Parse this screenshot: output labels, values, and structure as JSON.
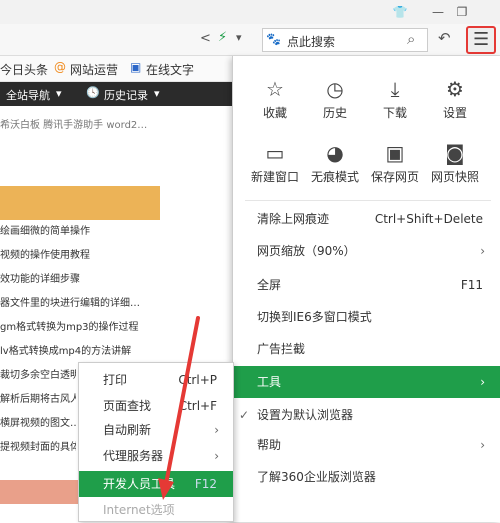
{
  "titlebar": {
    "pin_glyph": "👕",
    "min_glyph": "—",
    "restore_glyph": "❐"
  },
  "toolbar": {
    "share_glyph": "<",
    "bolt_glyph": "⚡",
    "dropdown_glyph": "▾",
    "paw_glyph": "🐾",
    "search_placeholder": "点此搜索",
    "search_glyph": "⌕",
    "undo_glyph": "↶",
    "menu_glyph": "☰"
  },
  "bookmarks": [
    {
      "icon": "",
      "label": "今日头条"
    },
    {
      "icon": "@",
      "label": "网站运营"
    },
    {
      "icon": "▣",
      "label": "在线文字"
    }
  ],
  "navbar": {
    "nav_label": "全站导航",
    "nav_arrow": "▾",
    "history_icon": "🕓",
    "history_label": "历史记录",
    "history_arrow": "▾"
  },
  "hotlinks": "希沃白板  腾讯手游助手  word2…",
  "articles": [
    "绘画细微的简单操作",
    "视频的操作使用教程",
    "效功能的详细步骤",
    "器文件里的块进行编辑的详细…",
    "gm格式转换为mp3的操作过程",
    "lv格式转换成mp4的方法讲解",
    "裁切多余空白透明…",
    "解析后期将古风人…",
    "横屏视频的图文…",
    "提视频封面的具体…"
  ],
  "mainmenu": {
    "icons": [
      {
        "glyph": "☆",
        "label": "收藏"
      },
      {
        "glyph": "◷",
        "label": "历史"
      },
      {
        "glyph": "⤓",
        "label": "下载"
      },
      {
        "glyph": "⚙",
        "label": "设置"
      },
      {
        "glyph": "▭",
        "label": "新建窗口"
      },
      {
        "glyph": "◕",
        "label": "无痕模式"
      },
      {
        "glyph": "▣",
        "label": "保存网页"
      },
      {
        "glyph": "◙",
        "label": "网页快照"
      }
    ],
    "items": [
      {
        "label": "清除上网痕迹",
        "shortcut": "Ctrl+Shift+Delete",
        "arrow": ""
      },
      {
        "label": "网页缩放（90%）",
        "shortcut": "",
        "arrow": "›"
      },
      {
        "label": "全屏",
        "shortcut": "F11",
        "arrow": ""
      },
      {
        "label": "切换到IE6多窗口模式",
        "shortcut": "",
        "arrow": ""
      },
      {
        "label": "广告拦截",
        "shortcut": "",
        "arrow": ""
      },
      {
        "label": "工具",
        "shortcut": "",
        "arrow": "›"
      },
      {
        "label": "设置为默认浏览器",
        "shortcut": "",
        "arrow": "",
        "check": "✓"
      },
      {
        "label": "帮助",
        "shortcut": "",
        "arrow": "›"
      },
      {
        "label": "了解360企业版浏览器",
        "shortcut": "",
        "arrow": ""
      }
    ]
  },
  "submenu": {
    "items": [
      {
        "label": "打印",
        "shortcut": "Ctrl+P",
        "arrow": ""
      },
      {
        "label": "页面查找",
        "shortcut": "Ctrl+F",
        "arrow": ""
      },
      {
        "label": "自动刷新",
        "shortcut": "",
        "arrow": "›"
      },
      {
        "label": "代理服务器",
        "shortcut": "",
        "arrow": "›"
      },
      {
        "label": "开发人员工具",
        "shortcut": "F12",
        "arrow": ""
      },
      {
        "label": "Internet选项",
        "shortcut": "",
        "arrow": ""
      }
    ]
  },
  "colors": {
    "green": "#1f9e4a",
    "accent_red": "#e53935",
    "orange": "#ecb357"
  }
}
